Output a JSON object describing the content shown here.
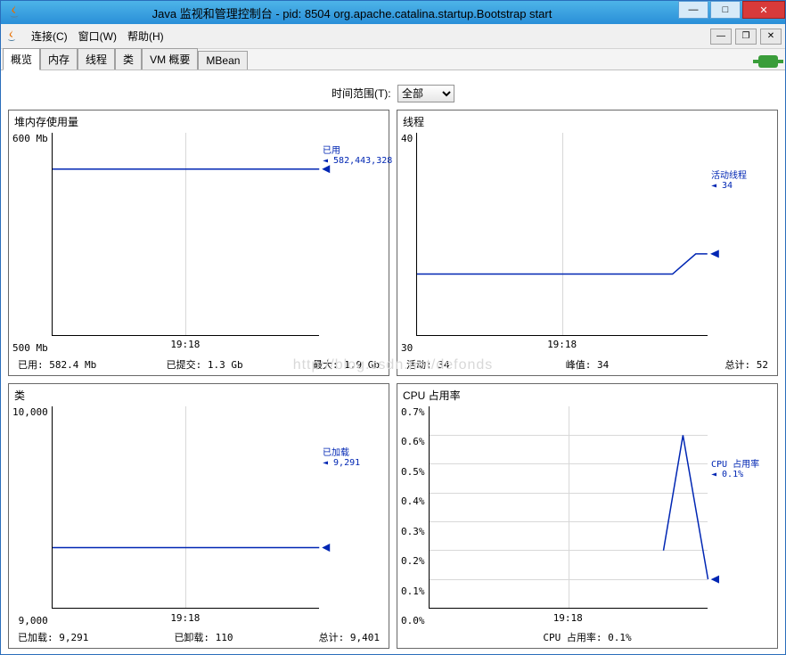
{
  "title": "Java 监视和管理控制台 - pid: 8504 org.apache.catalina.startup.Bootstrap start",
  "menu": {
    "connect": "连接(C)",
    "window": "窗口(W)",
    "help": "帮助(H)"
  },
  "tabs": [
    "概览",
    "内存",
    "线程",
    "类",
    "VM 概要",
    "MBean"
  ],
  "time_range": {
    "label": "时间范围(T):",
    "value": "全部"
  },
  "watermark": "http://blog.csdn.net/defonds",
  "chart_data": [
    {
      "type": "line",
      "title": "堆内存使用量",
      "ylabel_ticks": [
        "600 Mb",
        "500 Mb"
      ],
      "ylim": [
        500,
        600
      ],
      "x_tick": "19:18",
      "series": [
        {
          "name": "已用",
          "current_label": "582,443,328",
          "values": [
            582,
            582
          ],
          "legend_top_pct": 15
        }
      ],
      "stats": [
        {
          "k": "已用:",
          "v": "582.4  Mb"
        },
        {
          "k": "已提交:",
          "v": "1.3  Gb"
        },
        {
          "k": "最大:",
          "v": "1.9  Gb"
        }
      ],
      "poly": "0,18 90,18 100,18"
    },
    {
      "type": "line",
      "title": "线程",
      "ylabel_ticks": [
        "40",
        "30"
      ],
      "ylim": [
        30,
        40
      ],
      "x_tick": "19:18",
      "series": [
        {
          "name": "活动线程",
          "current_label": "34",
          "values": [
            33,
            34
          ],
          "legend_top_pct": 55
        }
      ],
      "stats": [
        {
          "k": "活动:",
          "v": "34"
        },
        {
          "k": "峰值:",
          "v": "34"
        },
        {
          "k": "总计:",
          "v": "52"
        }
      ],
      "poly": "0,70 88,70 96,60 100,60"
    },
    {
      "type": "line",
      "title": "类",
      "ylabel_ticks": [
        "10,000",
        "9,000"
      ],
      "ylim": [
        9000,
        10000
      ],
      "x_tick": "19:18",
      "series": [
        {
          "name": "已加载",
          "current_label": "9,291",
          "values": [
            9291,
            9291
          ],
          "legend_top_pct": 62
        }
      ],
      "stats": [
        {
          "k": "已加载:",
          "v": "9,291"
        },
        {
          "k": "已卸载:",
          "v": "110"
        },
        {
          "k": "总计:",
          "v": "9,401"
        }
      ],
      "poly": "0,70 90,70 100,70"
    },
    {
      "type": "line",
      "title": "CPU 占用率",
      "ylabel_ticks": [
        "0.7%",
        "0.6%",
        "0.5%",
        "0.4%",
        "0.3%",
        "0.2%",
        "0.1%",
        "0.0%"
      ],
      "ylim": [
        0,
        0.7
      ],
      "x_tick": "19:18",
      "series": [
        {
          "name": "CPU 占用率",
          "current_label": "0.1%",
          "values": [
            0.2,
            0.6,
            0.1
          ],
          "legend_top_pct": 80
        }
      ],
      "stats_center": {
        "k": "CPU 占用率:",
        "v": "0.1%"
      },
      "hlines": [
        14.3,
        28.6,
        42.9,
        57.1,
        71.4,
        85.7
      ],
      "poly": "84,71.4 91,14.3 100,85.7"
    }
  ]
}
